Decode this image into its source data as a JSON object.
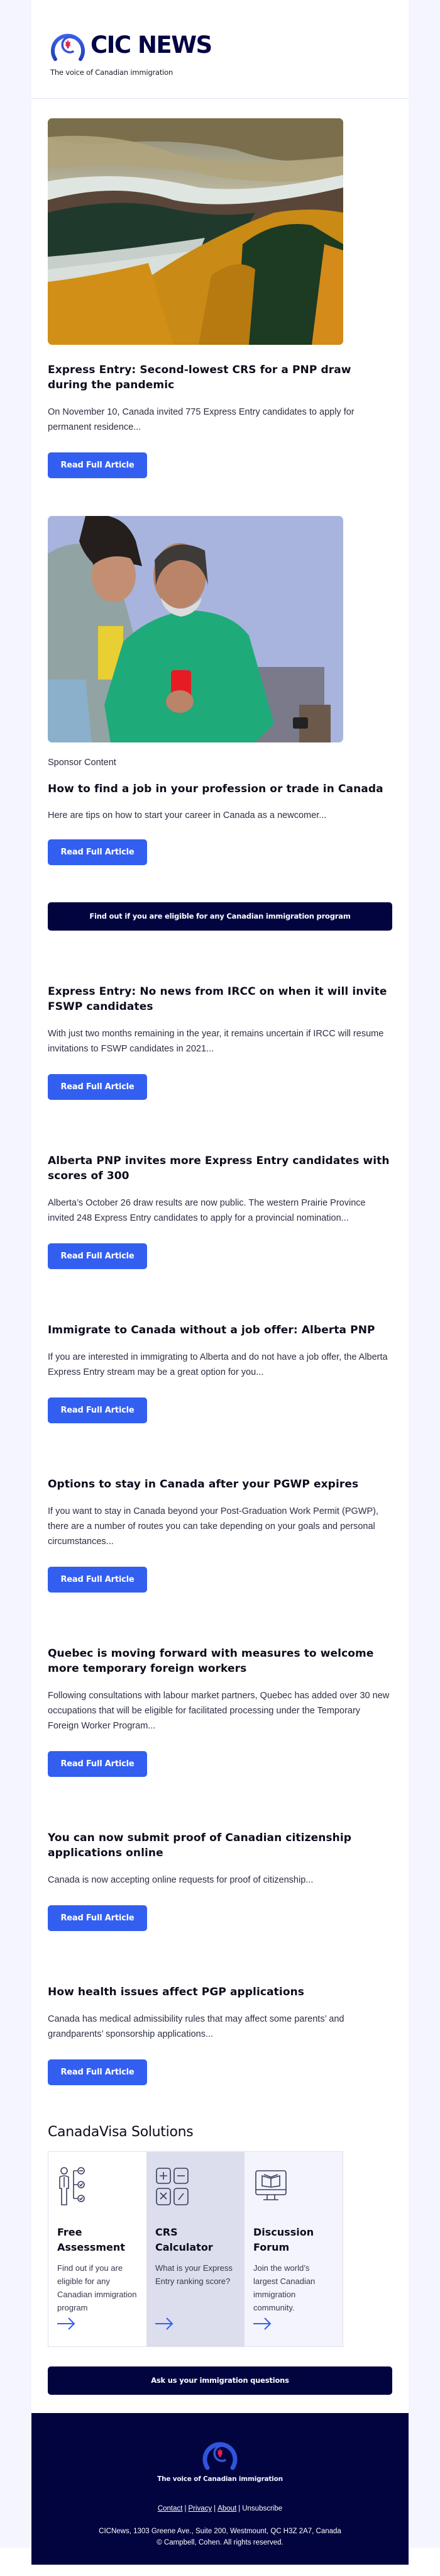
{
  "header": {
    "brand": "CIC NEWS",
    "tagline": "The voice of Canadian immigration"
  },
  "colors": {
    "accent": "#335ff0",
    "navy": "#02043f",
    "page_bg": "#f4f5fd",
    "maple_red": "#e8214f"
  },
  "read_label": "Read Full Article",
  "articles": [
    {
      "title": "Express Entry: Second-lowest CRS for a PNP draw during the pandemic",
      "excerpt": "On November 10, Canada invited 775 Express Entry candidates to apply for permanent residence...",
      "image": "autumn-forest-fog-photo"
    },
    {
      "sponsor_label": "Sponsor Content",
      "title": "How to find a job in your profession or trade in Canada",
      "excerpt": "Here are tips on how to start your career in Canada as a newcomer...",
      "image": "two-people-looking-at-phone-photo"
    },
    {
      "title": "Express Entry: No news from IRCC on when it will invite FSWP candidates",
      "excerpt": "With just two months remaining in the year, it remains uncertain if IRCC will resume invitations to FSWP candidates in 2021..."
    },
    {
      "title": "Alberta PNP invites more Express Entry candidates with scores of 300",
      "excerpt": "Alberta’s October 26 draw results are now public. The western Prairie Province invited 248 Express Entry candidates to apply for a provincial nomination..."
    },
    {
      "title": "Immigrate to Canada without a job offer: Alberta PNP",
      "excerpt": "If you are interested in immigrating to Alberta and do not have a job offer, the Alberta Express Entry stream may be a great option for you..."
    },
    {
      "title": "Options to stay in Canada after your PGWP expires",
      "excerpt": "If you want to stay in Canada beyond your Post-Graduation Work Permit (PGWP), there are a number of routes you can take depending on your goals and personal circumstances..."
    },
    {
      "title": "Quebec is moving forward with measures to welcome more temporary foreign workers",
      "excerpt": "Following consultations with labour market partners, Quebec has added over 30 new occupations that will be eligible for facilitated processing under the Temporary Foreign Worker Program..."
    },
    {
      "title": "You can now submit proof of Canadian citizenship applications online",
      "excerpt": "Canada is now accepting online requests for proof of citizenship..."
    },
    {
      "title": "How health issues affect PGP applications",
      "excerpt": "Canada has medical admissibility rules that may affect some parents’ and grandparents’ sponsorship applications..."
    }
  ],
  "eligibility_cta": "Find out if you are eligible for any Canadian immigration program",
  "solutions": {
    "title": "CanadaVisa Solutions",
    "items": [
      {
        "title": "Free Assessment",
        "description": "Find out if you are eligible for any Canadian immigration program",
        "icon": "assessment-checklist-icon"
      },
      {
        "title": "CRS Calculator",
        "description": "What is your Express Entry ranking score?",
        "icon": "calculator-icon"
      },
      {
        "title": "Discussion Forum",
        "description": "Join the world’s largest Canadian immigration community.",
        "icon": "monitor-book-icon"
      }
    ]
  },
  "questions_cta": "Ask us your immigration questions",
  "footer": {
    "tagline": "The voice of Canadian immigration",
    "links": [
      "Contact",
      "Privacy",
      "About",
      "Unsubscribe"
    ],
    "address": "CICNews, 1303 Greene Ave., Suite 200, Westmount, QC H3Z 2A7, Canada",
    "copyright": "© Campbell, Cohen. All rights reserved."
  }
}
